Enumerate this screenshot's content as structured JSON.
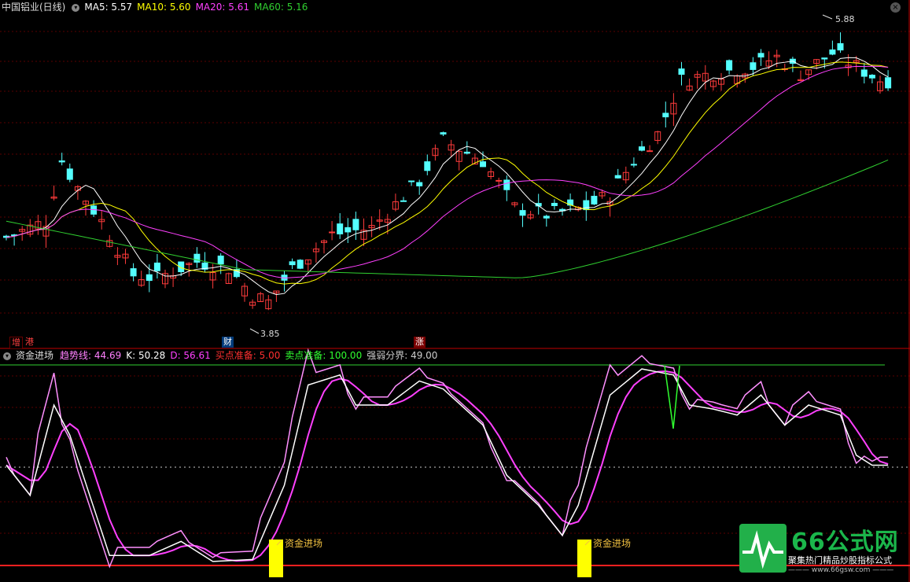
{
  "top_panel": {
    "title": "中国铝业(日线)",
    "indicators": [
      {
        "label": "MA5:",
        "value": "5.57",
        "color": "#ffffff"
      },
      {
        "label": "MA10:",
        "value": "5.60",
        "color": "#ffff00"
      },
      {
        "label": "MA20:",
        "value": "5.61",
        "color": "#ff40ff"
      },
      {
        "label": "MA60:",
        "value": "5.16",
        "color": "#30d030"
      }
    ],
    "high_label": "5.88",
    "low_label": "3.85",
    "event_tags": [
      "增",
      "港",
      "财",
      "涨"
    ]
  },
  "bottom_panel": {
    "title": "资金进场",
    "items": [
      {
        "label": "趋势线:",
        "value": "44.69",
        "color": "#ff80ff"
      },
      {
        "label": "K:",
        "value": "50.28",
        "color": "#ffffff"
      },
      {
        "label": "D:",
        "value": "56.61",
        "color": "#ff40ff"
      },
      {
        "label": "买点准备:",
        "value": "5.00",
        "color": "#ff3030"
      },
      {
        "label": "卖点准备:",
        "value": "100.00",
        "color": "#30ff30"
      },
      {
        "label": "强弱分界:",
        "value": "49.00",
        "color": "#cccccc"
      }
    ],
    "signal_label": "资金进场"
  },
  "logo": {
    "brand": "66公式网",
    "slogan": "聚集热门精品炒股指标公式",
    "url": "——— www.66gsw.com ———"
  },
  "colors": {
    "up_candle": "#ff3b3b",
    "down_candle": "#54ffff",
    "ma5": "#ffffff",
    "ma10": "#ffff00",
    "ma20": "#ff40ff",
    "ma60": "#30d030",
    "divider": "#c00000",
    "signal_bar": "#ffff00"
  }
}
